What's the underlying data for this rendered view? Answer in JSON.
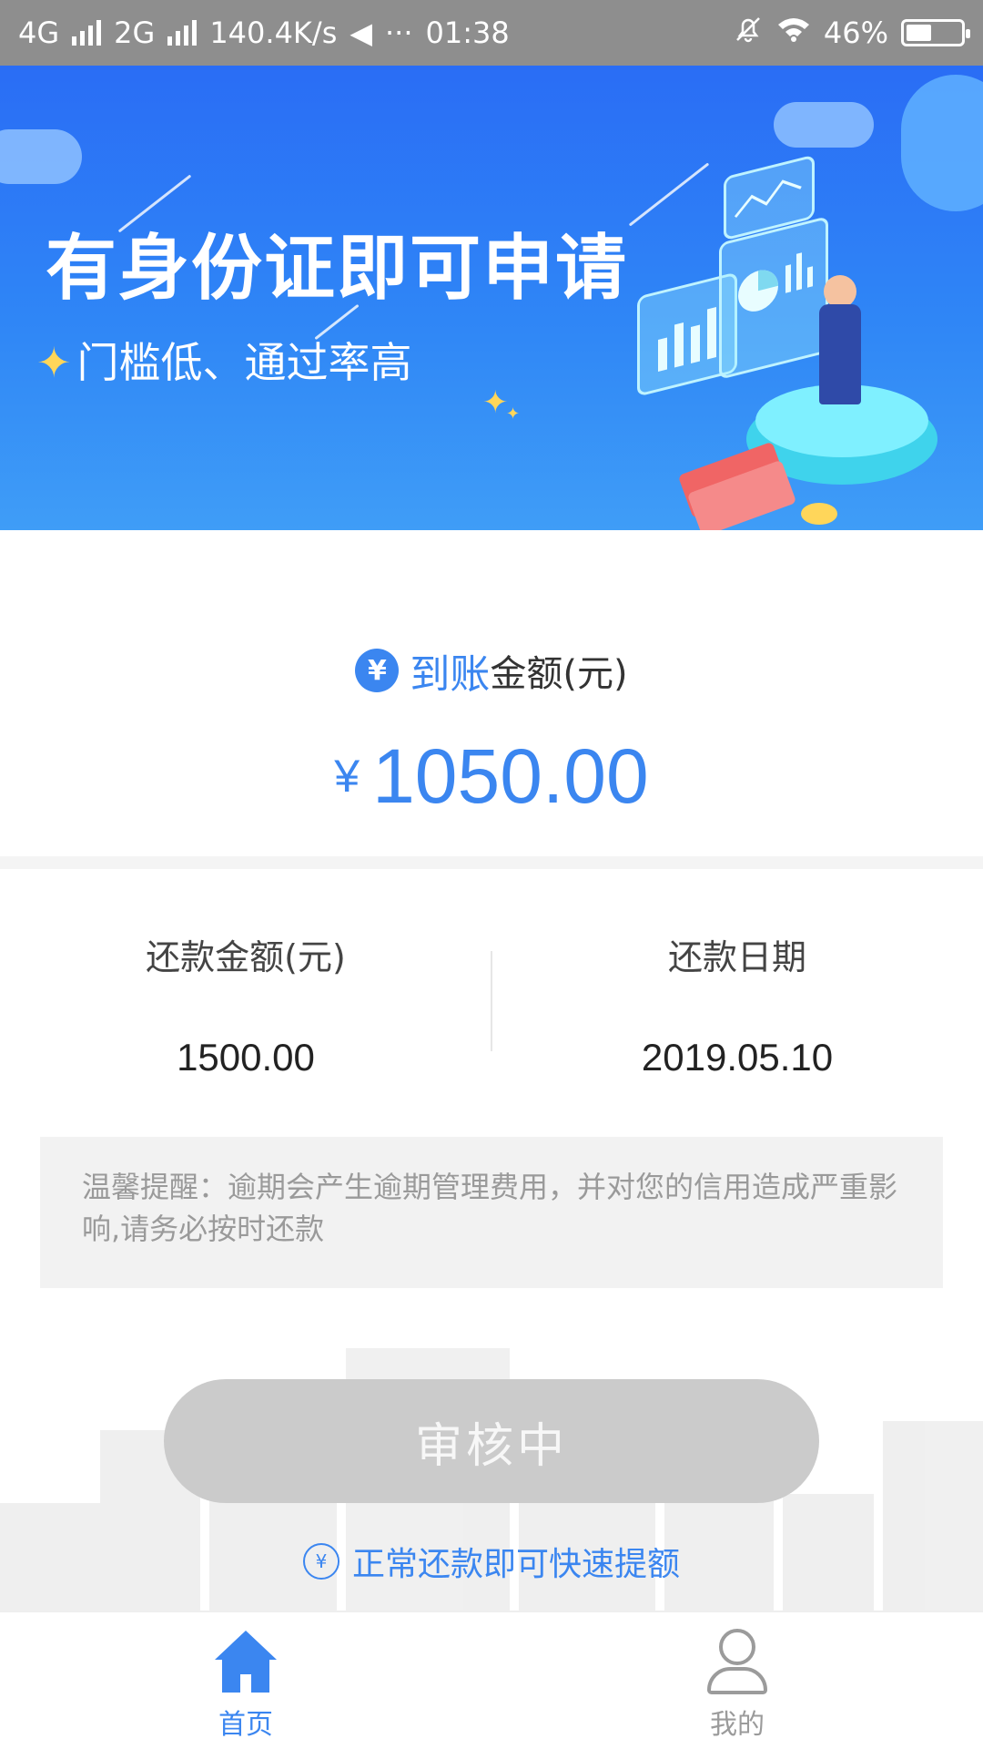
{
  "status_bar": {
    "network1": "4G",
    "network2": "2G",
    "speed": "140.4K/s",
    "dots": "···",
    "time": "01:38",
    "battery": "46%",
    "battery_level": 0.46
  },
  "banner": {
    "title": "有身份证即可申请",
    "subtitle": "门槛低、通过率高"
  },
  "arrival": {
    "label_blue": "到账",
    "label_rest": "金额(元)",
    "currency": "¥",
    "amount": "1050.00"
  },
  "repay": {
    "amount_label": "还款金额(元)",
    "amount_value": "1500.00",
    "date_label": "还款日期",
    "date_value": "2019.05.10"
  },
  "notice": "温馨提醒：逾期会产生逾期管理费用，并对您的信用造成严重影响,请务必按时还款",
  "status_button": "审核中",
  "tip": "正常还款即可快速提额",
  "tabs": [
    {
      "label": "首页",
      "icon": "home-icon",
      "active": true
    },
    {
      "label": "我的",
      "icon": "user-icon",
      "active": false
    }
  ],
  "colors": {
    "accent": "#3b86f0",
    "button_disabled": "#cbcbcb",
    "status_bar": "#8e8e8e"
  }
}
